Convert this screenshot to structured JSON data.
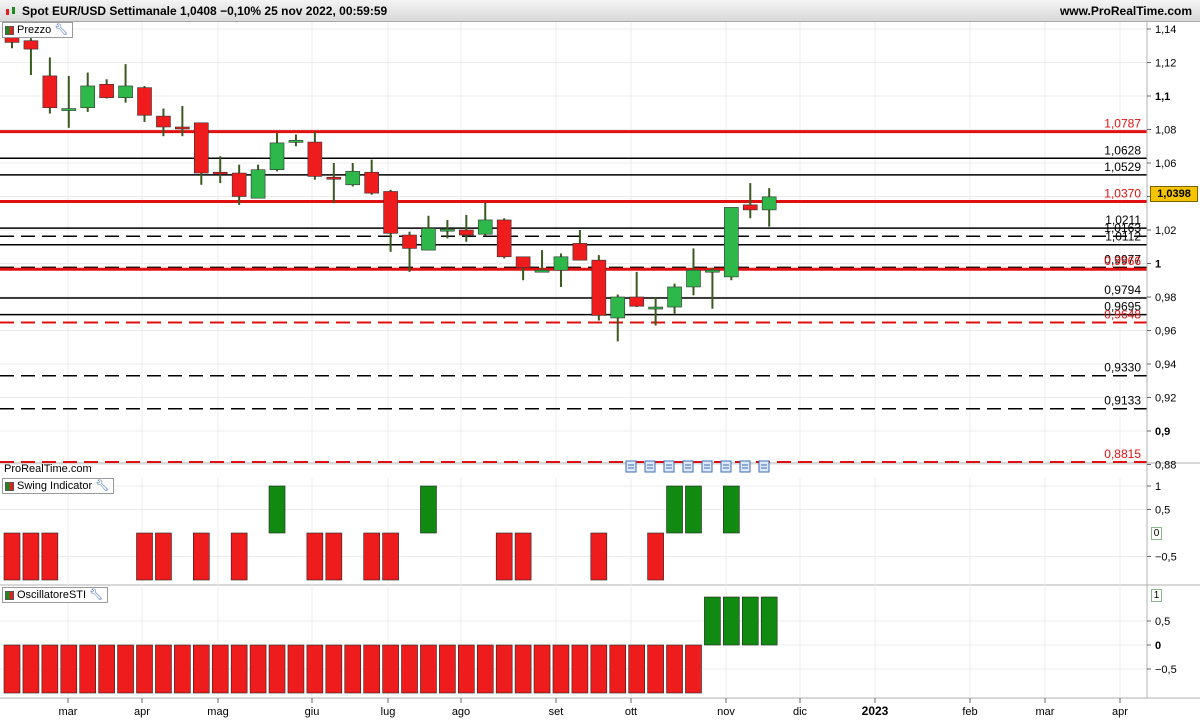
{
  "header": {
    "title": "Spot EUR/USD Settimanale 1,0408 −0,10% 25 nov 2022, 00:59:59",
    "site": "www.ProRealTime.com"
  },
  "panels": {
    "price_label": "Prezzo",
    "swing_label": "Swing Indicator",
    "sti_label": "OscillatoreSTI"
  },
  "watermark": "ProRealTime.com",
  "last_price": "1,0398",
  "swing_zero_box": "0",
  "sti_one_box": "1",
  "colors": {
    "up": "#2eb84a",
    "down": "#ee1c1c",
    "green_bar": "#118a11",
    "red_bar": "#ee1c1c",
    "level_red": "#e01010"
  },
  "chart_data": [
    {
      "type": "candlestick",
      "x_labels": [
        "mar",
        "apr",
        "mag",
        "giu",
        "lug",
        "ago",
        "set",
        "ott",
        "nov",
        "dic",
        "2023",
        "feb",
        "mar",
        "apr"
      ],
      "y_ticks": [
        {
          "v": 1.14,
          "label": "1,14"
        },
        {
          "v": 1.12,
          "label": "1,12"
        },
        {
          "v": 1.1,
          "label": "1,1",
          "bold": true
        },
        {
          "v": 1.08,
          "label": "1,08"
        },
        {
          "v": 1.06,
          "label": "1,06"
        },
        {
          "v": 1.04,
          "label": "1,04"
        },
        {
          "v": 1.02,
          "label": "1,02"
        },
        {
          "v": 1.0,
          "label": "1",
          "bold": true
        },
        {
          "v": 0.98,
          "label": "0,98"
        },
        {
          "v": 0.96,
          "label": "0,96"
        },
        {
          "v": 0.94,
          "label": "0,94"
        },
        {
          "v": 0.92,
          "label": "0,92"
        },
        {
          "v": 0.9,
          "label": "0,9",
          "bold": true
        },
        {
          "v": 0.88,
          "label": "0,88"
        }
      ],
      "ylim": [
        0.8765,
        1.1465
      ],
      "candles": [
        {
          "o": 1.1375,
          "h": 1.142,
          "l": 1.1285,
          "c": 1.132
        },
        {
          "o": 1.133,
          "h": 1.1345,
          "l": 1.1125,
          "c": 1.128
        },
        {
          "o": 1.112,
          "h": 1.123,
          "l": 1.0895,
          "c": 1.093
        },
        {
          "o": 1.0925,
          "h": 1.112,
          "l": 1.081,
          "c": 1.0925
        },
        {
          "o": 1.093,
          "h": 1.114,
          "l": 1.0905,
          "c": 1.106
        },
        {
          "o": 1.107,
          "h": 1.11,
          "l": 1.0985,
          "c": 1.099
        },
        {
          "o": 1.099,
          "h": 1.119,
          "l": 1.096,
          "c": 1.106
        },
        {
          "o": 1.105,
          "h": 1.106,
          "l": 1.0845,
          "c": 1.0885
        },
        {
          "o": 1.088,
          "h": 1.0925,
          "l": 1.076,
          "c": 1.0815
        },
        {
          "o": 1.0815,
          "h": 1.094,
          "l": 1.076,
          "c": 1.0805
        },
        {
          "o": 1.084,
          "h": 1.084,
          "l": 1.047,
          "c": 1.054
        },
        {
          "o": 1.0545,
          "h": 1.064,
          "l": 1.048,
          "c": 1.054
        },
        {
          "o": 1.054,
          "h": 1.059,
          "l": 1.035,
          "c": 1.04
        },
        {
          "o": 1.039,
          "h": 1.059,
          "l": 1.039,
          "c": 1.056
        },
        {
          "o": 1.056,
          "h": 1.078,
          "l": 1.055,
          "c": 1.072
        },
        {
          "o": 1.073,
          "h": 1.077,
          "l": 1.07,
          "c": 1.0735
        },
        {
          "o": 1.0725,
          "h": 1.0785,
          "l": 1.05,
          "c": 1.052
        },
        {
          "o": 1.0515,
          "h": 1.06,
          "l": 1.036,
          "c": 1.051
        },
        {
          "o": 1.047,
          "h": 1.06,
          "l": 1.046,
          "c": 1.055
        },
        {
          "o": 1.0545,
          "h": 1.062,
          "l": 1.041,
          "c": 1.042
        },
        {
          "o": 1.043,
          "h": 1.044,
          "l": 1.007,
          "c": 1.018
        },
        {
          "o": 1.017,
          "h": 1.019,
          "l": 0.995,
          "c": 1.009
        },
        {
          "o": 1.008,
          "h": 1.0285,
          "l": 1.008,
          "c": 1.021
        },
        {
          "o": 1.0205,
          "h": 1.026,
          "l": 1.015,
          "c": 1.0205
        },
        {
          "o": 1.02,
          "h": 1.029,
          "l": 1.013,
          "c": 1.017
        },
        {
          "o": 1.0175,
          "h": 1.0365,
          "l": 1.0165,
          "c": 1.026
        },
        {
          "o": 1.026,
          "h": 1.027,
          "l": 1.003,
          "c": 1.004
        },
        {
          "o": 1.004,
          "h": 1.004,
          "l": 0.99,
          "c": 0.9975
        },
        {
          "o": 0.996,
          "h": 1.008,
          "l": 0.995,
          "c": 0.996
        },
        {
          "o": 0.996,
          "h": 1.006,
          "l": 0.986,
          "c": 1.004
        },
        {
          "o": 1.012,
          "h": 1.02,
          "l": 1.003,
          "c": 1.002
        },
        {
          "o": 1.002,
          "h": 1.005,
          "l": 0.966,
          "c": 0.969
        },
        {
          "o": 0.9675,
          "h": 0.9815,
          "l": 0.9535,
          "c": 0.98
        },
        {
          "o": 0.98,
          "h": 0.995,
          "l": 0.974,
          "c": 0.9745
        },
        {
          "o": 0.974,
          "h": 0.98,
          "l": 0.963,
          "c": 0.974
        },
        {
          "o": 0.974,
          "h": 0.988,
          "l": 0.97,
          "c": 0.986
        },
        {
          "o": 0.986,
          "h": 1.009,
          "l": 0.981,
          "c": 0.996
        },
        {
          "o": 0.996,
          "h": 0.9975,
          "l": 0.973,
          "c": 0.996
        },
        {
          "o": 0.992,
          "h": 1.0335,
          "l": 0.99,
          "c": 1.0335
        },
        {
          "o": 1.035,
          "h": 1.048,
          "l": 1.027,
          "c": 1.032
        },
        {
          "o": 1.032,
          "h": 1.045,
          "l": 1.022,
          "c": 1.0398
        }
      ],
      "levels": [
        {
          "v": 1.0787,
          "label": "1,0787",
          "color": "#e01010",
          "width": 3,
          "dashed": false
        },
        {
          "v": 1.0628,
          "label": "1,0628",
          "color": "#000000",
          "width": 1.5,
          "dashed": false
        },
        {
          "v": 1.0529,
          "label": "1,0529",
          "color": "#000000",
          "width": 1.5,
          "dashed": false
        },
        {
          "v": 1.037,
          "label": "1,0370",
          "color": "#e01010",
          "width": 3,
          "dashed": false
        },
        {
          "v": 1.0211,
          "label": "1,0211",
          "color": "#000000",
          "width": 1.5,
          "dashed": false
        },
        {
          "v": 1.0163,
          "label": "1,0163",
          "color": "#000000",
          "width": 1.5,
          "dashed": true
        },
        {
          "v": 1.0112,
          "label": "1,0112",
          "color": "#000000",
          "width": 1.5,
          "dashed": false
        },
        {
          "v": 0.9977,
          "label": "0,9977",
          "color": "#000000",
          "width": 1.5,
          "dashed": true
        },
        {
          "v": 0.9966,
          "label": "0,9966",
          "color": "#e01010",
          "width": 3,
          "dashed": false
        },
        {
          "v": 0.9794,
          "label": "0,9794",
          "color": "#000000",
          "width": 1.5,
          "dashed": false
        },
        {
          "v": 0.9695,
          "label": "0,9695",
          "color": "#000000",
          "width": 1.5,
          "dashed": false
        },
        {
          "v": 0.9648,
          "label": "0,9648",
          "color": "#e01010",
          "width": 2,
          "dashed": true
        },
        {
          "v": 0.933,
          "label": "0,9330",
          "color": "#000000",
          "width": 1.5,
          "dashed": true
        },
        {
          "v": 0.9133,
          "label": "0,9133",
          "color": "#000000",
          "width": 1.5,
          "dashed": true
        },
        {
          "v": 0.8815,
          "label": "0,8815",
          "color": "#e01010",
          "width": 2,
          "dashed": true
        }
      ]
    },
    {
      "type": "bar",
      "name": "Swing Indicator",
      "y_ticks": [
        {
          "v": 1,
          "label": "1"
        },
        {
          "v": 0.5,
          "label": "0,5"
        },
        {
          "v": -0.5,
          "label": "−0,5"
        }
      ],
      "ylim": [
        -1.0,
        1.0
      ],
      "values": [
        -1,
        -1,
        -1,
        0,
        0,
        0,
        0,
        -1,
        -1,
        0,
        -1,
        0,
        -1,
        0,
        1,
        0,
        -1,
        -1,
        0,
        -1,
        -1,
        0,
        1,
        0,
        0,
        0,
        -1,
        -1,
        0,
        0,
        0,
        -1,
        0,
        0,
        -1,
        1,
        1,
        0,
        1,
        0,
        0
      ]
    },
    {
      "type": "bar",
      "name": "OscillatoreSTI",
      "y_ticks": [
        {
          "v": 0.5,
          "label": "0,5"
        },
        {
          "v": 0,
          "label": "0",
          "bold": true
        },
        {
          "v": -0.5,
          "label": "−0,5"
        }
      ],
      "ylim": [
        -1.0,
        1.0
      ],
      "values": [
        -1,
        -1,
        -1,
        -1,
        -1,
        -1,
        -1,
        -1,
        -1,
        -1,
        -1,
        -1,
        -1,
        -1,
        -1,
        -1,
        -1,
        -1,
        -1,
        -1,
        -1,
        -1,
        -1,
        -1,
        -1,
        -1,
        -1,
        -1,
        -1,
        -1,
        -1,
        -1,
        -1,
        -1,
        -1,
        -1,
        -1,
        1,
        1,
        1,
        1
      ]
    }
  ]
}
